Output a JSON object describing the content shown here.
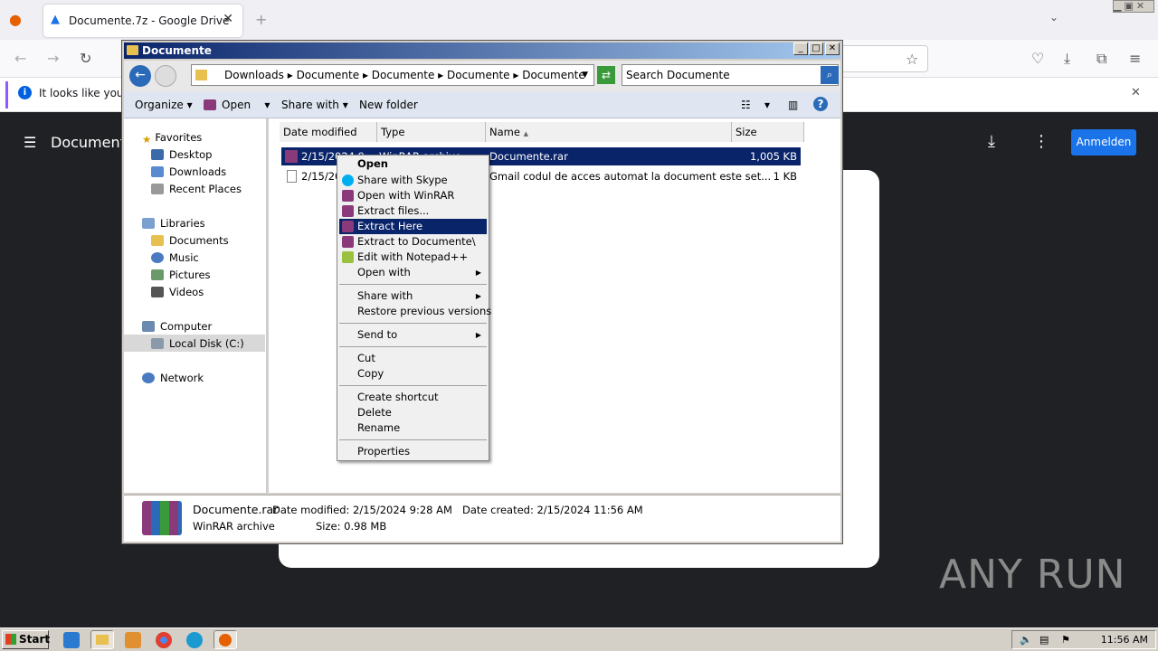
{
  "browser": {
    "tab_title": "Documente.7z - Google Drive",
    "infobar_text": "It looks like you ha"
  },
  "drive": {
    "title": "Document",
    "signin_label": "Anmelden"
  },
  "watermark": "ANY RUN",
  "explorer": {
    "window_title": "Documente",
    "breadcrumb": [
      "Downloads",
      "Documente",
      "Documente",
      "Documente",
      "Documente"
    ],
    "search_placeholder": "Search Documente",
    "toolbar": {
      "organize": "Organize",
      "open": "Open",
      "share_with": "Share with",
      "new_folder": "New folder"
    },
    "nav": {
      "favorites": "Favorites",
      "desktop": "Desktop",
      "downloads": "Downloads",
      "recent": "Recent Places",
      "libraries": "Libraries",
      "documents": "Documents",
      "music": "Music",
      "pictures": "Pictures",
      "videos": "Videos",
      "computer": "Computer",
      "local_disk": "Local Disk (C:)",
      "network": "Network"
    },
    "columns": {
      "date": "Date modified",
      "type": "Type",
      "name": "Name",
      "size": "Size"
    },
    "files": [
      {
        "date": "2/15/2024 9",
        "type": "WinRAR archive",
        "name": "Documente.rar",
        "size": "1,005 KB"
      },
      {
        "date": "2/15/20",
        "type": "",
        "name": "Gmail codul de acces automat la document este set...",
        "size": "1 KB"
      }
    ],
    "details": {
      "filename": "Documente.rar",
      "filetype": "WinRAR archive",
      "date_modified": "Date modified:  2/15/2024 9:28 AM",
      "date_created": "Date created:  2/15/2024 11:56 AM",
      "size": "Size:  0.98 MB"
    }
  },
  "context_menu": {
    "open": "Open",
    "share_skype": "Share with Skype",
    "open_winrar": "Open with WinRAR",
    "extract_files": "Extract files...",
    "extract_here": "Extract Here",
    "extract_to": "Extract to Documente\\",
    "edit_notepad": "Edit with Notepad++",
    "open_with": "Open with",
    "share_with": "Share with",
    "restore": "Restore previous versions",
    "send_to": "Send to",
    "cut": "Cut",
    "copy": "Copy",
    "create_shortcut": "Create shortcut",
    "delete": "Delete",
    "rename": "Rename",
    "properties": "Properties"
  },
  "taskbar": {
    "start": "Start",
    "clock": "11:56 AM"
  }
}
